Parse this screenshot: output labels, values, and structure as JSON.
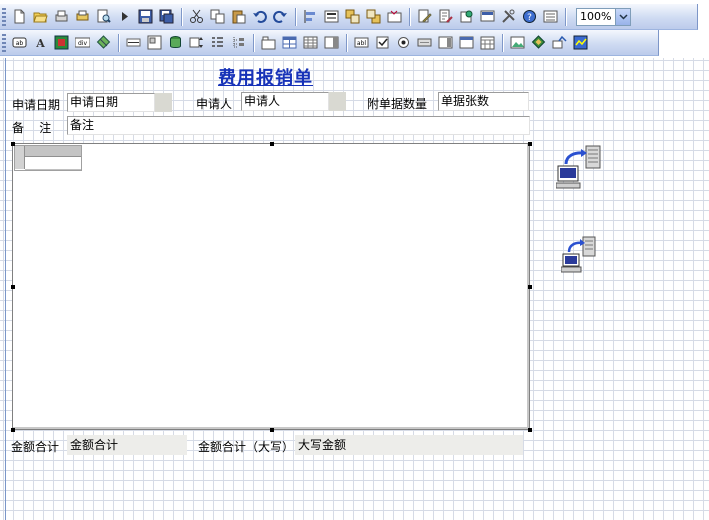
{
  "toolbar_main": {
    "zoom_value": "100%",
    "icons": [
      "new-file-icon",
      "open-folder-icon",
      "print-preview-icon",
      "print-icon",
      "preview-icon",
      "run-icon",
      "save-icon",
      "save-as-icon",
      "cut-icon",
      "copy-icon",
      "paste-icon",
      "undo-icon",
      "redo-icon",
      "align-icon",
      "properties-icon",
      "bring-front-icon",
      "send-back-icon",
      "tab-order-icon",
      "edit-icon",
      "edit-script-icon",
      "data-source-icon",
      "event-icon",
      "tools-icon",
      "help-icon",
      "options-icon"
    ]
  },
  "toolbar_controls": {
    "icons": [
      "textbox-icon",
      "label-icon",
      "image-icon",
      "div-icon",
      "shape-icon",
      "line-icon",
      "frame-icon",
      "database-icon",
      "spinner-icon",
      "list-icon",
      "tree-icon",
      "tab-icon",
      "table-icon",
      "grid-icon",
      "panel-icon",
      "abl-icon",
      "checkbox-icon",
      "radio-icon",
      "button-icon",
      "combo-icon",
      "menu-icon",
      "calendar-icon",
      "picture-icon",
      "chart-icon",
      "export-icon",
      "report-icon"
    ]
  },
  "form": {
    "title": "费用报销单",
    "apply_date_label": "申请日期",
    "apply_date_value": "申请日期",
    "applicant_label": "申请人",
    "applicant_value": "申请人",
    "attach_count_label": "附单据数量",
    "attach_count_value": "单据张数",
    "remark_label": "备    注",
    "remark_value": "备注",
    "total_label": "金额合计",
    "total_value": "金额合计",
    "total_upper_label": "金额合计（大写）",
    "total_upper_value": "大写金额"
  }
}
